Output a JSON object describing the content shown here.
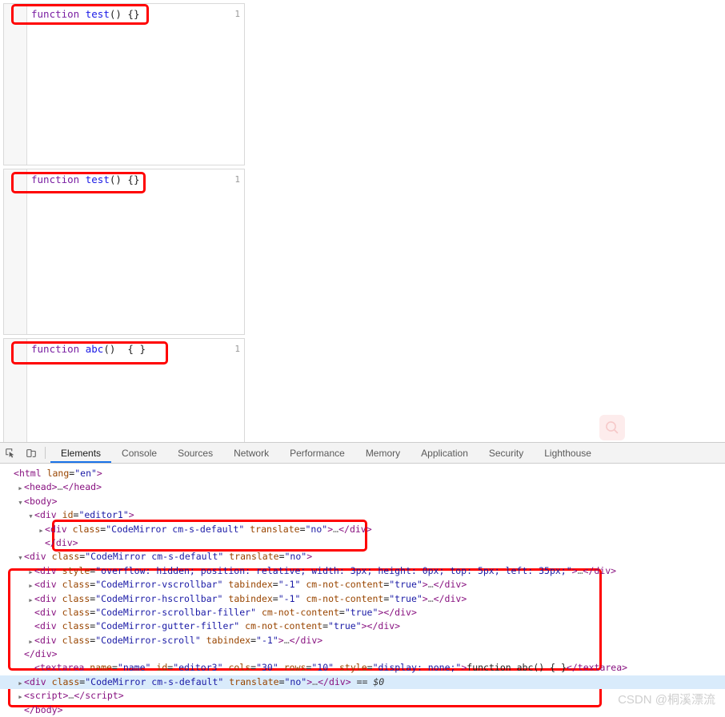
{
  "page": {
    "editors": [
      {
        "id": "editor1",
        "line_number": "1",
        "keyword": "function",
        "name": "test",
        "tail": "() {}"
      },
      {
        "id": "editor2",
        "line_number": "1",
        "keyword": "function",
        "name": "test",
        "tail": "() {}"
      },
      {
        "id": "editor3",
        "line_number": "1",
        "keyword": "function",
        "name": "abc",
        "tail": "()  { }"
      }
    ],
    "search_button": {
      "icon": "search-icon",
      "label": ""
    },
    "colors": {
      "keyword": "#7a1fa2",
      "definition": "#1a1ae6",
      "annotation": "#ff0000",
      "accent": "#1a73e8"
    }
  },
  "devtools": {
    "toolbar": {
      "inspect_icon": "inspect-element-icon",
      "device_icon": "device-toolbar-icon"
    },
    "tabs": [
      {
        "label": "Elements",
        "active": true
      },
      {
        "label": "Console",
        "active": false
      },
      {
        "label": "Sources",
        "active": false
      },
      {
        "label": "Network",
        "active": false
      },
      {
        "label": "Performance",
        "active": false
      },
      {
        "label": "Memory",
        "active": false
      },
      {
        "label": "Application",
        "active": false
      },
      {
        "label": "Security",
        "active": false
      },
      {
        "label": "Lighthouse",
        "active": false
      }
    ],
    "dom": {
      "rows": [
        {
          "indent": 0,
          "twisty": "none",
          "html": "<span class=\"brk\">&lt;</span><span class=\"tag\">html</span> <span class=\"attr\">lang</span><span class=\"txt\">=</span><span class=\"val\">\"en\"</span><span class=\"brk\">&gt;</span>"
        },
        {
          "indent": 1,
          "twisty": "closed",
          "html": "<span class=\"brk\">&lt;</span><span class=\"tag\">head</span><span class=\"brk\">&gt;</span><span class=\"dots\">…</span><span class=\"brk\">&lt;/</span><span class=\"tag\">head</span><span class=\"brk\">&gt;</span>"
        },
        {
          "indent": 1,
          "twisty": "open",
          "html": "<span class=\"brk\">&lt;</span><span class=\"tag\">body</span><span class=\"brk\">&gt;</span>"
        },
        {
          "indent": 2,
          "twisty": "open",
          "html": "<span class=\"brk\">&lt;</span><span class=\"tag\">div</span> <span class=\"attr\">id</span><span class=\"txt\">=</span><span class=\"val\">\"editor1\"</span><span class=\"brk\">&gt;</span>"
        },
        {
          "indent": 3,
          "twisty": "closed",
          "html": "<span class=\"brk\">&lt;</span><span class=\"tag\">div</span> <span class=\"attr\">class</span><span class=\"txt\">=</span><span class=\"val\">\"CodeMirror cm-s-default\"</span> <span class=\"attr\">translate</span><span class=\"txt\">=</span><span class=\"val\">\"no\"</span><span class=\"brk\">&gt;</span><span class=\"dots\">…</span><span class=\"brk\">&lt;/</span><span class=\"tag\">div</span><span class=\"brk\">&gt;</span>"
        },
        {
          "indent": 3,
          "twisty": "none",
          "html": "<span class=\"brk\">&lt;/</span><span class=\"tag\">div</span><span class=\"brk\">&gt;</span>"
        },
        {
          "indent": 1,
          "twisty": "open",
          "html": "<span class=\"brk\">&lt;</span><span class=\"tag\">div</span> <span class=\"attr\">class</span><span class=\"txt\">=</span><span class=\"val\">\"CodeMirror cm-s-default\"</span> <span class=\"attr\">translate</span><span class=\"txt\">=</span><span class=\"val\">\"no\"</span><span class=\"brk\">&gt;</span>"
        },
        {
          "indent": 2,
          "twisty": "closed",
          "html": "<span class=\"brk\">&lt;</span><span class=\"tag\">div</span> <span class=\"attr\">style</span><span class=\"txt\">=</span><span class=\"val\">\"overflow: hidden; position: relative; width: 3px; height: 0px; top: 5px; left: 35px;\"</span><span class=\"brk\">&gt;</span><span class=\"dots\">…</span><span class=\"brk\">&lt;/</span><span class=\"tag\">div</span><span class=\"brk\">&gt;</span>"
        },
        {
          "indent": 2,
          "twisty": "closed",
          "html": "<span class=\"brk\">&lt;</span><span class=\"tag\">div</span> <span class=\"attr\">class</span><span class=\"txt\">=</span><span class=\"val\">\"CodeMirror-vscrollbar\"</span> <span class=\"attr\">tabindex</span><span class=\"txt\">=</span><span class=\"val\">\"-1\"</span> <span class=\"attr\">cm-not-content</span><span class=\"txt\">=</span><span class=\"val\">\"true\"</span><span class=\"brk\">&gt;</span><span class=\"dots\">…</span><span class=\"brk\">&lt;/</span><span class=\"tag\">div</span><span class=\"brk\">&gt;</span>"
        },
        {
          "indent": 2,
          "twisty": "closed",
          "html": "<span class=\"brk\">&lt;</span><span class=\"tag\">div</span> <span class=\"attr\">class</span><span class=\"txt\">=</span><span class=\"val\">\"CodeMirror-hscrollbar\"</span> <span class=\"attr\">tabindex</span><span class=\"txt\">=</span><span class=\"val\">\"-1\"</span> <span class=\"attr\">cm-not-content</span><span class=\"txt\">=</span><span class=\"val\">\"true\"</span><span class=\"brk\">&gt;</span><span class=\"dots\">…</span><span class=\"brk\">&lt;/</span><span class=\"tag\">div</span><span class=\"brk\">&gt;</span>"
        },
        {
          "indent": 2,
          "twisty": "none",
          "html": "<span class=\"brk\">&lt;</span><span class=\"tag\">div</span> <span class=\"attr\">class</span><span class=\"txt\">=</span><span class=\"val\">\"CodeMirror-scrollbar-filler\"</span> <span class=\"attr\">cm-not-content</span><span class=\"txt\">=</span><span class=\"val\">\"true\"</span><span class=\"brk\">&gt;</span><span class=\"brk\">&lt;/</span><span class=\"tag\">div</span><span class=\"brk\">&gt;</span>"
        },
        {
          "indent": 2,
          "twisty": "none",
          "html": "<span class=\"brk\">&lt;</span><span class=\"tag\">div</span> <span class=\"attr\">class</span><span class=\"txt\">=</span><span class=\"val\">\"CodeMirror-gutter-filler\"</span> <span class=\"attr\">cm-not-content</span><span class=\"txt\">=</span><span class=\"val\">\"true\"</span><span class=\"brk\">&gt;</span><span class=\"brk\">&lt;/</span><span class=\"tag\">div</span><span class=\"brk\">&gt;</span>"
        },
        {
          "indent": 2,
          "twisty": "closed",
          "html": "<span class=\"brk\">&lt;</span><span class=\"tag\">div</span> <span class=\"attr\">class</span><span class=\"txt\">=</span><span class=\"val\">\"CodeMirror-scroll\"</span> <span class=\"attr\">tabindex</span><span class=\"txt\">=</span><span class=\"val\">\"-1\"</span><span class=\"brk\">&gt;</span><span class=\"dots\">…</span><span class=\"brk\">&lt;/</span><span class=\"tag\">div</span><span class=\"brk\">&gt;</span>"
        },
        {
          "indent": 1,
          "twisty": "none",
          "html": "<span class=\"brk\">&lt;/</span><span class=\"tag\">div</span><span class=\"brk\">&gt;</span>"
        },
        {
          "indent": 2,
          "twisty": "none",
          "html": "<span class=\"brk\">&lt;</span><span class=\"tag\">textarea</span> <span class=\"attr\">name</span><span class=\"txt\">=</span><span class=\"val\">\"name\"</span> <span class=\"attr\">id</span><span class=\"txt\">=</span><span class=\"val\">\"editor3\"</span> <span class=\"attr\">cols</span><span class=\"txt\">=</span><span class=\"val\">\"30\"</span> <span class=\"attr\">rows</span><span class=\"txt\">=</span><span class=\"val\">\"10\"</span> <span class=\"attr\">style</span><span class=\"txt\">=</span><span class=\"val\">\"display: none;\"</span><span class=\"brk\">&gt;</span><span class=\"txt\">function abc() { }</span><span class=\"brk\">&lt;/</span><span class=\"tag\">textarea</span><span class=\"brk\">&gt;</span>"
        },
        {
          "indent": 1,
          "twisty": "closed",
          "selected": true,
          "html": "<span class=\"brk\">&lt;</span><span class=\"tag\">div</span> <span class=\"attr\">class</span><span class=\"txt\">=</span><span class=\"val\">\"CodeMirror cm-s-default\"</span> <span class=\"attr\">translate</span><span class=\"txt\">=</span><span class=\"val\">\"no\"</span><span class=\"brk\">&gt;</span><span class=\"dots\">…</span><span class=\"brk\">&lt;/</span><span class=\"tag\">div</span><span class=\"brk\">&gt;</span> <span class=\"sel0\">== $0</span>"
        },
        {
          "indent": 1,
          "twisty": "closed",
          "html": "<span class=\"brk\">&lt;</span><span class=\"tag\">script</span><span class=\"brk\">&gt;</span><span class=\"dots\">…</span><span class=\"brk\">&lt;/</span><span class=\"tag\">script</span><span class=\"brk\">&gt;</span>"
        },
        {
          "indent": 1,
          "twisty": "none",
          "html": "<span class=\"brk\">&lt;/</span><span class=\"tag\">body</span><span class=\"brk\">&gt;</span>"
        }
      ]
    }
  },
  "watermark": {
    "text": "CSDN @桐溪漂流"
  }
}
